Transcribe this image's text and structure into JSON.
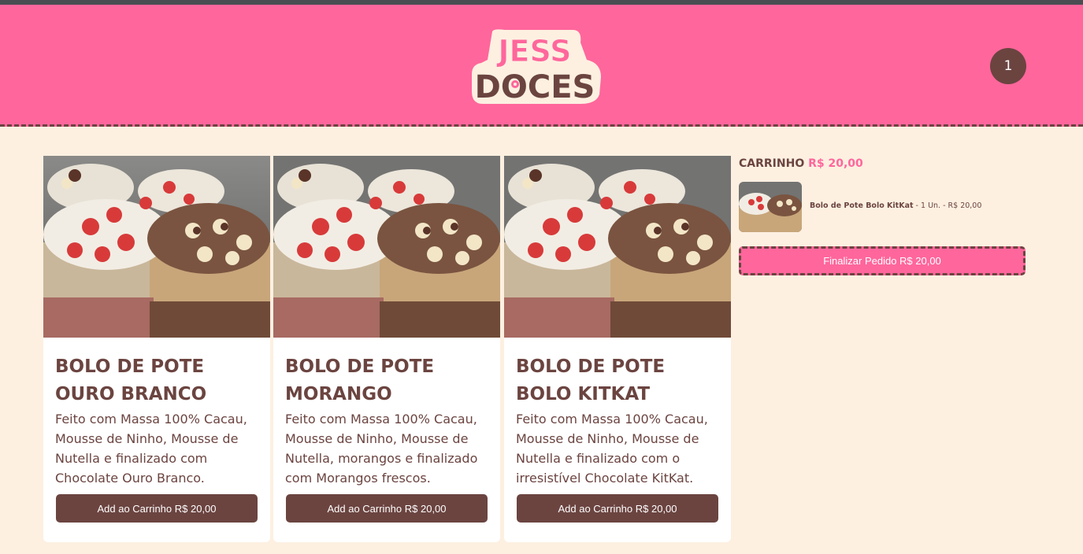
{
  "header": {
    "logo_line1": "JESS",
    "logo_line2": "DOCES",
    "cart_count": "1"
  },
  "products": [
    {
      "title": "BOLO DE POTE OURO BRANCO",
      "description": "Feito com Massa 100% Cacau, Mousse de Ninho, Mousse de Nutella e finalizado com Chocolate Ouro Branco.",
      "button_label": "Add ao Carrinho R$ 20,00"
    },
    {
      "title": "BOLO DE POTE MORANGO",
      "description": "Feito com Massa 100% Cacau, Mousse de Ninho, Mousse de Nutella, morangos e finalizado com Morangos frescos.",
      "button_label": "Add ao Carrinho R$ 20,00"
    },
    {
      "title": "BOLO DE POTE BOLO KITKAT",
      "description": "Feito com Massa 100% Cacau, Mousse de Ninho, Mousse de Nutella e finalizado com o irresistível Chocolate KitKat.",
      "button_label": "Add ao Carrinho R$ 20,00"
    }
  ],
  "cart": {
    "title": "CARRINHO",
    "total": "R$ 20,00",
    "items": [
      {
        "name": "Bolo de Pote Bolo KitKat",
        "details": " - 1 Un. - R$ 20,00"
      }
    ],
    "checkout_label": "Finalizar Pedido R$ 20,00"
  },
  "colors": {
    "brand_pink": "#ff669c",
    "brand_brown": "#6b4440",
    "page_background": "#fdf0e1"
  }
}
